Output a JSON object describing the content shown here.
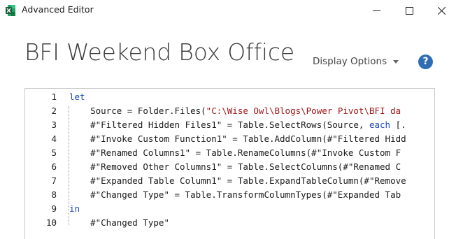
{
  "window": {
    "title": "Advanced Editor",
    "app_icon": "excel-icon",
    "controls": {
      "minimize": "minimize-icon",
      "maximize": "maximize-icon",
      "close": "close-icon"
    }
  },
  "header": {
    "query_name": "BFI Weekend Box Office",
    "display_options_label": "Display Options",
    "help_label": "?"
  },
  "colors": {
    "keyword": "#1f49b6",
    "string": "#a31515",
    "help_icon": "#2f6db5"
  },
  "editor": {
    "lines": [
      {
        "number": "1",
        "segments": [
          {
            "t": "let",
            "k": "kw"
          }
        ]
      },
      {
        "number": "2",
        "segments": [
          {
            "t": "    Source = Folder.Files(",
            "k": ""
          },
          {
            "t": "\"C:\\Wise Owl\\Blogs\\Power Pivot\\BFI da",
            "k": "str"
          }
        ]
      },
      {
        "number": "3",
        "segments": [
          {
            "t": "    #\"Filtered Hidden Files1\" = Table.SelectRows(Source, ",
            "k": ""
          },
          {
            "t": "each",
            "k": "kw"
          },
          {
            "t": " [.",
            "k": ""
          }
        ]
      },
      {
        "number": "4",
        "segments": [
          {
            "t": "    #\"Invoke Custom Function1\" = Table.AddColumn(#\"Filtered Hidd",
            "k": ""
          }
        ]
      },
      {
        "number": "5",
        "segments": [
          {
            "t": "    #\"Renamed Columns1\" = Table.RenameColumns(#\"Invoke Custom F",
            "k": ""
          }
        ]
      },
      {
        "number": "6",
        "segments": [
          {
            "t": "    #\"Removed Other Columns1\" = Table.SelectColumns(#\"Renamed C",
            "k": ""
          }
        ]
      },
      {
        "number": "7",
        "segments": [
          {
            "t": "    #\"Expanded Table Column1\" = Table.ExpandTableColumn(#\"Remove",
            "k": ""
          }
        ]
      },
      {
        "number": "8",
        "segments": [
          {
            "t": "    #\"Changed Type\" = Table.TransformColumnTypes(#\"Expanded Tab",
            "k": ""
          }
        ]
      },
      {
        "number": "9",
        "segments": [
          {
            "t": "in",
            "k": "kw"
          }
        ]
      },
      {
        "number": "10",
        "segments": [
          {
            "t": "    #\"Changed Type\"",
            "k": ""
          }
        ]
      }
    ]
  }
}
